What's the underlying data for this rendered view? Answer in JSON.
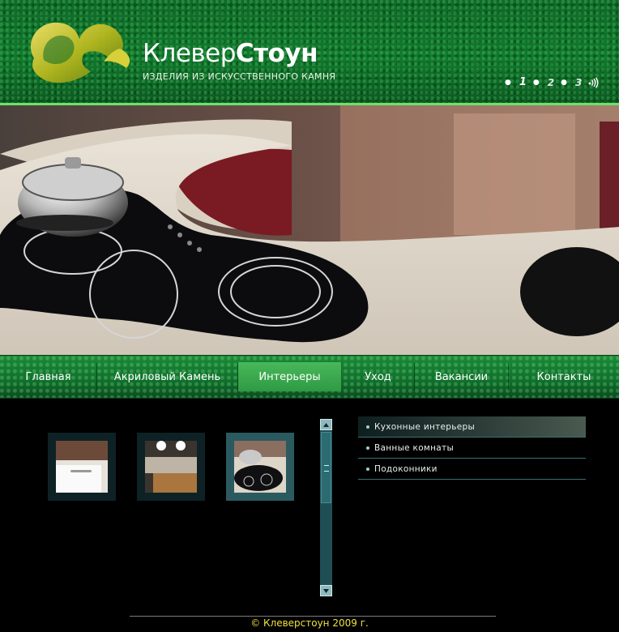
{
  "header": {
    "brand_part1": "Клевер",
    "brand_part2": "Стоун",
    "tagline": "ИЗДЕЛИЯ ИЗ ИСКУССТВЕННОГО КАМНЯ",
    "slides": [
      "1",
      "2",
      "3"
    ],
    "active_slide": "1"
  },
  "nav": {
    "items": [
      {
        "label": "Главная"
      },
      {
        "label": "Акриловый Камень"
      },
      {
        "label": "Интерьеры"
      },
      {
        "label": "Уход"
      },
      {
        "label": "Вакансии"
      },
      {
        "label": "Контакты"
      }
    ],
    "active": "Интерьеры"
  },
  "gallery": {
    "thumbnails": [
      "kitchen-cabinet",
      "kitchen-lighting",
      "kitchen-cooktop"
    ],
    "active_index": 2
  },
  "submenu": {
    "items": [
      {
        "label": "Кухонные интерьеры"
      },
      {
        "label": "Ванные комнаты"
      },
      {
        "label": "Подоконники"
      }
    ],
    "active": "Кухонные интерьеры"
  },
  "footer": {
    "text": "© Клеверстоун 2009 г."
  },
  "colors": {
    "header_green": "#0f7a2e",
    "accent_line": "#6ee06e",
    "nav_active": "#2f9a44",
    "footer_text": "#f0e040",
    "panel_teal": "#2a5a60"
  }
}
